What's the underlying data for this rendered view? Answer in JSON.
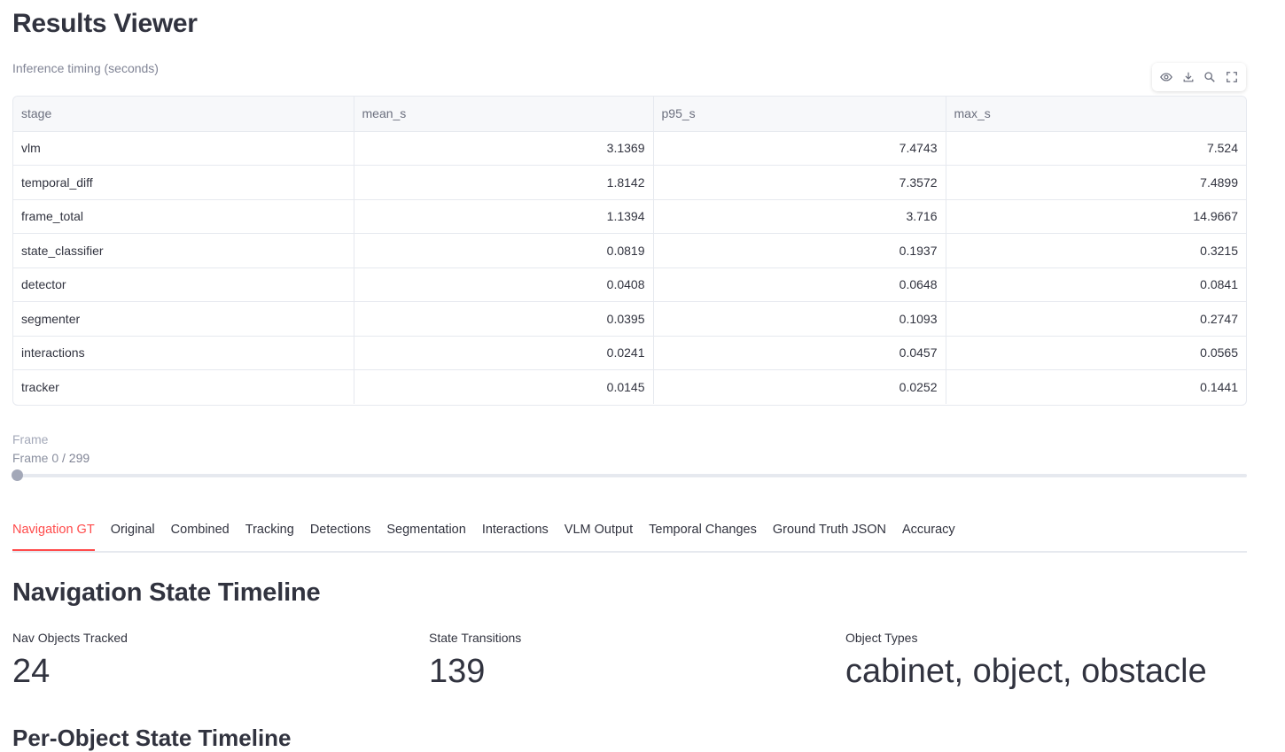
{
  "page": {
    "title": "Results Viewer"
  },
  "timing": {
    "caption": "Inference timing (seconds)",
    "columns": [
      "stage",
      "mean_s",
      "p95_s",
      "max_s"
    ],
    "rows": [
      [
        "vlm",
        "3.1369",
        "7.4743",
        "7.524"
      ],
      [
        "temporal_diff",
        "1.8142",
        "7.3572",
        "7.4899"
      ],
      [
        "frame_total",
        "1.1394",
        "3.716",
        "14.9667"
      ],
      [
        "state_classifier",
        "0.0819",
        "0.1937",
        "0.3215"
      ],
      [
        "detector",
        "0.0408",
        "0.0648",
        "0.0841"
      ],
      [
        "segmenter",
        "0.0395",
        "0.1093",
        "0.2747"
      ],
      [
        "interactions",
        "0.0241",
        "0.0457",
        "0.0565"
      ],
      [
        "tracker",
        "0.0145",
        "0.0252",
        "0.1441"
      ]
    ],
    "toolbar_icons": [
      "eye-icon",
      "download-icon",
      "search-icon",
      "fullscreen-icon"
    ]
  },
  "frame_slider": {
    "label": "Frame",
    "value_prefix": "Frame",
    "value": "0",
    "max_text": "/ 299",
    "current": 0,
    "max": 299
  },
  "tabs": [
    "Navigation GT",
    "Original",
    "Combined",
    "Tracking",
    "Detections",
    "Segmentation",
    "Interactions",
    "VLM Output",
    "Temporal Changes",
    "Ground Truth JSON",
    "Accuracy"
  ],
  "active_tab": "Navigation GT",
  "nav": {
    "title": "Navigation State Timeline",
    "metrics": [
      {
        "label": "Nav Objects Tracked",
        "value": "24"
      },
      {
        "label": "State Transitions",
        "value": "139"
      },
      {
        "label": "Object Types",
        "value": "cabinet, object, obstacle"
      }
    ],
    "subtitle": "Per-Object State Timeline"
  },
  "colors": {
    "accent": "#ff4b4b",
    "text": "#31333f",
    "muted": "#808495",
    "border": "#e6e9ef"
  }
}
